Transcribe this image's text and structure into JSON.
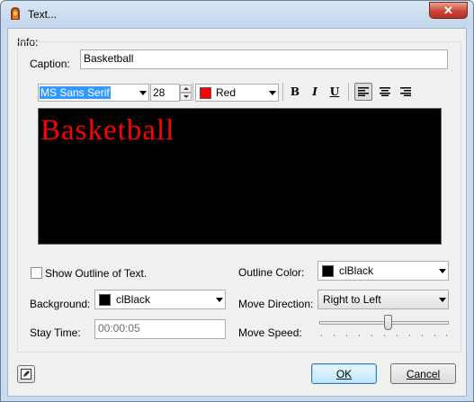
{
  "window": {
    "title": "Text..."
  },
  "info": {
    "group_label": "Info:",
    "caption_label": "Caption:",
    "caption_value": "Basketball"
  },
  "toolbar": {
    "font_name": "MS Sans Serif",
    "font_size": "28",
    "color_name": "Red",
    "color_hex": "#ff0000",
    "bold": "B",
    "italic": "I",
    "underline": "U"
  },
  "preview": {
    "text": "Basketball",
    "text_color": "#ff0000",
    "background": "#000000"
  },
  "options": {
    "show_outline_label": "Show Outline of Text.",
    "show_outline_checked": false,
    "outline_color_label": "Outline Color:",
    "outline_color_value": "clBlack",
    "background_label": "Background:",
    "background_value": "clBlack",
    "move_direction_label": "Move Direction:",
    "move_direction_value": "Right to Left",
    "stay_time_label": "Stay Time:",
    "stay_time_value": "00:00:05",
    "move_speed_label": "Move Speed:"
  },
  "buttons": {
    "ok": "OK",
    "cancel": "Cancel"
  }
}
